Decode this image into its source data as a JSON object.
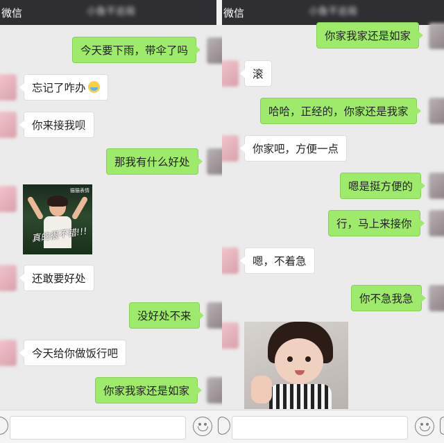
{
  "left_panel": {
    "header": {
      "back_label": "微信",
      "title": "小鱼干总局"
    },
    "messages": [
      {
        "side": "out",
        "text": "今天要下雨，带伞了吗"
      },
      {
        "side": "in",
        "text": "忘记了咋办",
        "emoji": "crying-face-icon"
      },
      {
        "side": "in",
        "text": "你来接我呗"
      },
      {
        "side": "out",
        "text": "那我有什么好处"
      },
      {
        "side": "in",
        "type": "sticker",
        "caption": "真的很不错!!!",
        "watermark": "猫猫表情"
      },
      {
        "side": "in",
        "text": "还敢要好处"
      },
      {
        "side": "out",
        "text": "没好处不来"
      },
      {
        "side": "in",
        "text": "今天给你做饭行吧"
      },
      {
        "side": "out",
        "text": "你家我家还是如家"
      }
    ]
  },
  "right_panel": {
    "header": {
      "back_label": "微信",
      "title": "小鱼干总局"
    },
    "messages": [
      {
        "side": "out",
        "text": "你家我家还是如家"
      },
      {
        "side": "in",
        "text": "滚"
      },
      {
        "side": "out",
        "text": "哈哈，正经的，你家还是我家"
      },
      {
        "side": "in",
        "text": "你家吧，方便一点"
      },
      {
        "side": "out",
        "text": "嗯是挺方便的"
      },
      {
        "side": "out",
        "text": "行，马上来接你"
      },
      {
        "side": "in",
        "text": "嗯，不着急"
      },
      {
        "side": "out",
        "text": "你不急我急"
      },
      {
        "side": "in",
        "type": "sticker",
        "description": "girl-photo"
      }
    ]
  },
  "colors": {
    "outgoing_bubble": "#9eea6a",
    "incoming_bubble": "#ffffff",
    "header": "#2f2f33",
    "chat_bg": "#ebebeb"
  },
  "icons": [
    "voice-icon",
    "emoji-icon",
    "more-icon"
  ]
}
